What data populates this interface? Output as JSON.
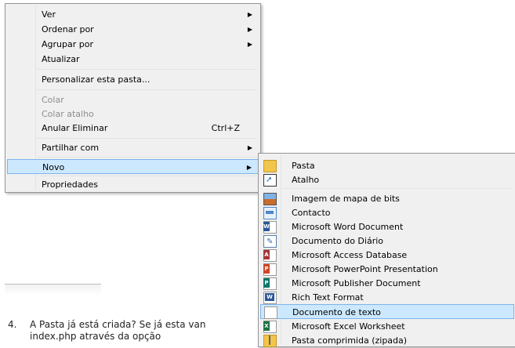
{
  "document": {
    "line1_number": "4.",
    "line1_text": "A Pasta já está criada? Se já esta van",
    "line2_text": "index.php através da opção"
  },
  "context_menu": {
    "items": [
      {
        "label": "Ver",
        "submenu": true
      },
      {
        "label": "Ordenar por",
        "submenu": true
      },
      {
        "label": "Agrupar por",
        "submenu": true
      },
      {
        "label": "Atualizar"
      },
      {
        "label": "Personalizar esta pasta..."
      },
      {
        "label": "Colar",
        "disabled": true
      },
      {
        "label": "Colar atalho",
        "disabled": true
      },
      {
        "label": "Anular Eliminar",
        "shortcut": "Ctrl+Z"
      },
      {
        "label": "Partilhar com",
        "submenu": true
      },
      {
        "label": "Novo",
        "submenu": true,
        "highlighted": true
      },
      {
        "label": "Propriedades"
      }
    ],
    "submenu_arrow": "▶"
  },
  "new_submenu": {
    "items": [
      {
        "label": "Pasta",
        "icon": "folder-icon"
      },
      {
        "label": "Atalho",
        "icon": "shortcut-icon"
      },
      {
        "label": "Imagem de mapa de bits",
        "icon": "bitmap-image-icon"
      },
      {
        "label": "Contacto",
        "icon": "contact-icon"
      },
      {
        "label": "Microsoft Word Document",
        "icon": "word-document-icon"
      },
      {
        "label": "Documento do Diário",
        "icon": "journal-document-icon"
      },
      {
        "label": "Microsoft Access Database",
        "icon": "access-database-icon"
      },
      {
        "label": "Microsoft PowerPoint Presentation",
        "icon": "powerpoint-icon"
      },
      {
        "label": "Microsoft Publisher Document",
        "icon": "publisher-icon"
      },
      {
        "label": "Rich Text Format",
        "icon": "rich-text-icon"
      },
      {
        "label": "Documento de texto",
        "icon": "text-document-icon",
        "highlighted": true
      },
      {
        "label": "Microsoft Excel Worksheet",
        "icon": "excel-worksheet-icon"
      },
      {
        "label": "Pasta comprimida (zipada)",
        "icon": "zip-folder-icon"
      }
    ]
  },
  "colors": {
    "menu_bg": "#f0f0f0",
    "highlight_bg": "#cce8ff",
    "highlight_border": "#7eb4ea",
    "disabled_text": "#8d8d8d"
  }
}
